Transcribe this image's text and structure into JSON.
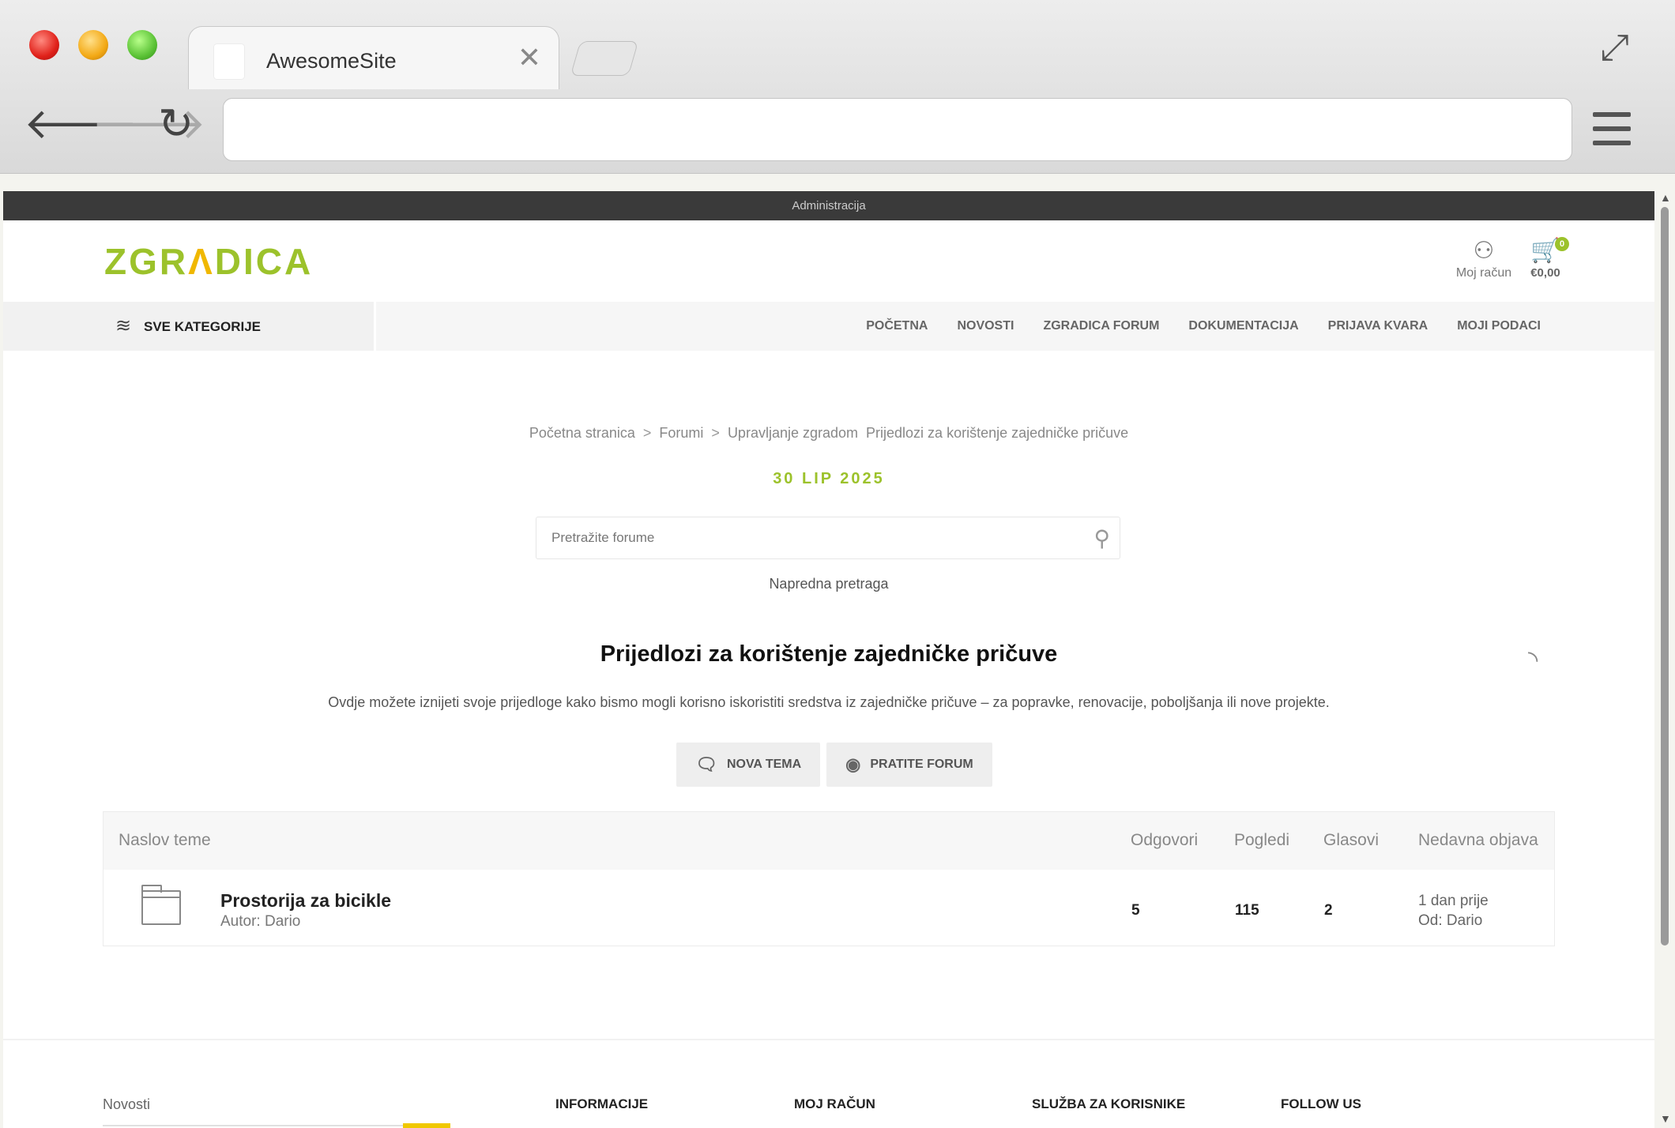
{
  "browser": {
    "tab_title": "AwesomeSite",
    "tab_close": "✕",
    "url": ""
  },
  "site": {
    "admin_bar": "Administracija",
    "logo_pre": "ZGR",
    "logo_a": "Λ",
    "logo_post": "DICA",
    "account_label": "Moj račun",
    "cart_total": "€0,00",
    "cart_count": "0",
    "all_categories": "SVE KATEGORIJE",
    "nav": [
      "POČETNA",
      "NOVOSTI",
      "ZGRADICA FORUM",
      "DOKUMENTACIJA",
      "PRIJAVA KVARA",
      "MOJI PODACI"
    ],
    "accent_color": "#9cc22b"
  },
  "breadcrumb": {
    "items": [
      "Početna stranica",
      "Forumi",
      "Upravljanje zgradom",
      "Prijedlozi za korištenje zajedničke pričuve"
    ],
    "sep": ">"
  },
  "date": "30 LIP 2025",
  "search": {
    "placeholder": "Pretražite forume",
    "advanced": "Napredna pretraga"
  },
  "forum": {
    "title": "Prijedlozi za korištenje zajedničke pričuve",
    "description": "Ovdje možete iznijeti svoje prijedloge kako bismo mogli korisno iskoristiti sredstva iz zajedničke pričuve – za popravke, renovacije, poboljšanja ili nove projekte.",
    "new_topic": "NOVA TEMA",
    "follow": "PRATITE FORUM"
  },
  "table": {
    "headers": {
      "topic": "Naslov teme",
      "replies": "Odgovori",
      "views": "Pogledi",
      "votes": "Glasovi",
      "recent": "Nedavna objava"
    },
    "rows": [
      {
        "title": "Prostorija za bicikle",
        "author": "Autor: Dario",
        "replies": "5",
        "views": "115",
        "votes": "2",
        "recent_time": "1 dan prije",
        "recent_by": "Od: Dario"
      }
    ]
  },
  "footer": {
    "news": "Novosti",
    "info": "INFORMACIJE",
    "account": "MOJ RAČUN",
    "service": "SLUŽBA ZA KORISNIKE",
    "follow": "FOLLOW US"
  }
}
